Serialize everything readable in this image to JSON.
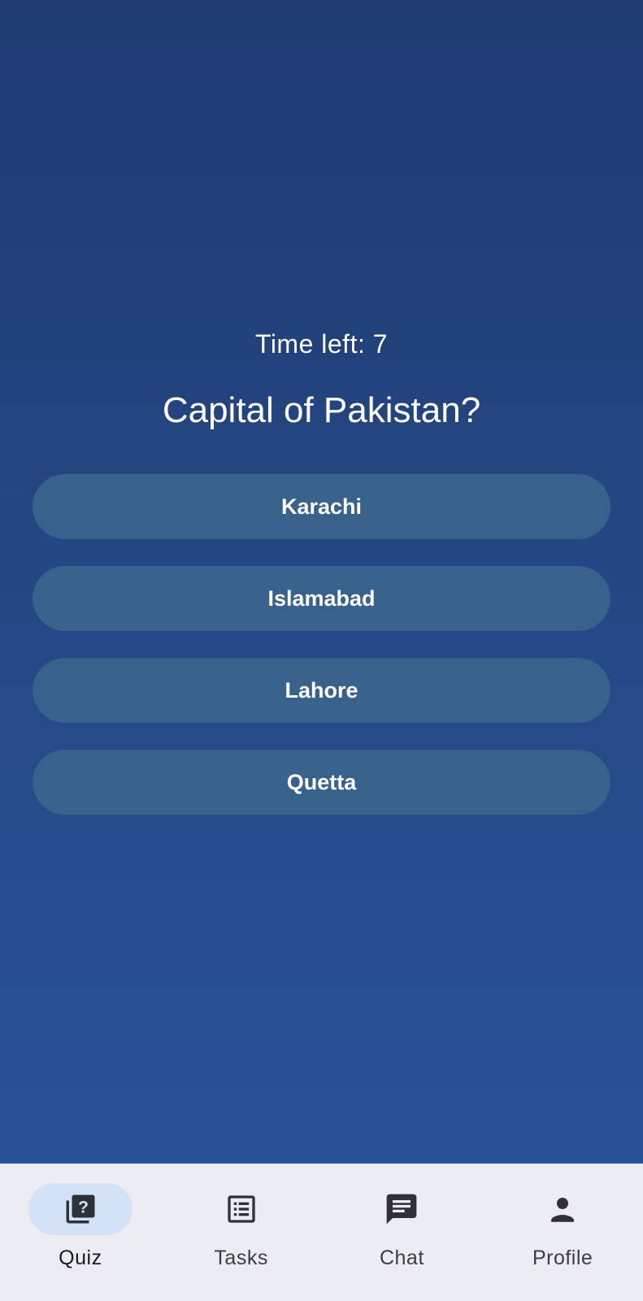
{
  "quiz": {
    "timer_text": "Time left: 7",
    "question": "Capital of Pakistan?",
    "options": [
      {
        "label": "Karachi"
      },
      {
        "label": "Islamabad"
      },
      {
        "label": "Lahore"
      },
      {
        "label": "Quetta"
      }
    ]
  },
  "nav": {
    "active": "Quiz",
    "items": [
      {
        "label": "Quiz",
        "icon": "quiz-icon"
      },
      {
        "label": "Tasks",
        "icon": "list-icon"
      },
      {
        "label": "Chat",
        "icon": "chat-icon"
      },
      {
        "label": "Profile",
        "icon": "person-icon"
      }
    ]
  },
  "colors": {
    "background_top": "#1f3b70",
    "background_bottom": "#2a5298",
    "option_button": "#38618c",
    "navbar": "#ecedf2",
    "active_pill": "#d4e2f7",
    "text_light": "#ffffff",
    "icon_dark": "#2e3138"
  }
}
